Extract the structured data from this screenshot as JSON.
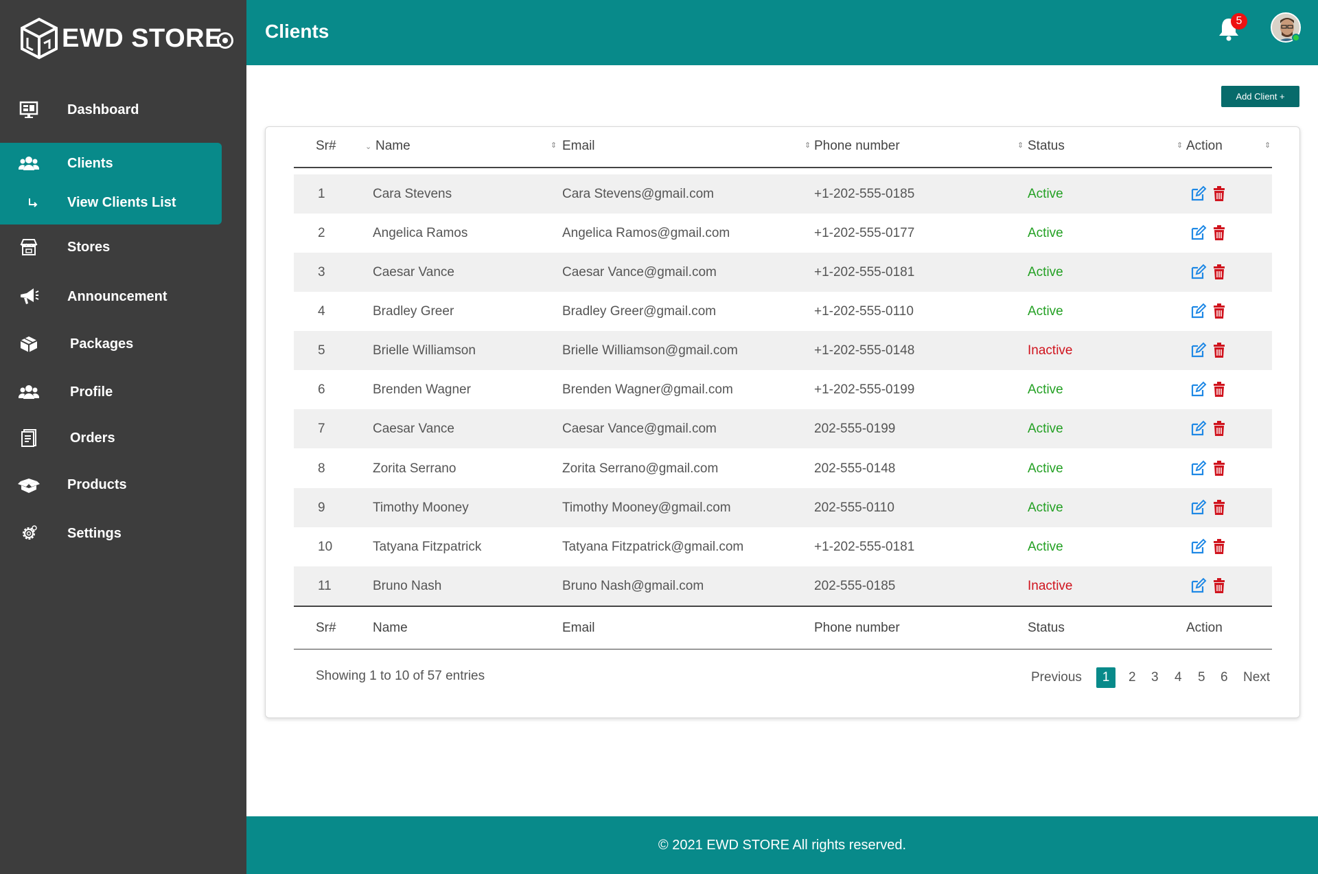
{
  "brand": {
    "name": "EWD STORE"
  },
  "header": {
    "title": "Clients",
    "notification_count": "5"
  },
  "sidebar": {
    "items": [
      {
        "label": "Dashboard",
        "icon": "monitor-icon"
      },
      {
        "label": "Clients",
        "icon": "users-icon"
      },
      {
        "label": "View Clients List",
        "icon": "subitem-arrow-icon"
      },
      {
        "label": "Stores",
        "icon": "store-icon"
      },
      {
        "label": "Announcement",
        "icon": "megaphone-icon"
      },
      {
        "label": "Packages",
        "icon": "packages-icon"
      },
      {
        "label": "Profile",
        "icon": "profile-icon"
      },
      {
        "label": "Orders",
        "icon": "orders-icon"
      },
      {
        "label": "Products",
        "icon": "products-icon"
      },
      {
        "label": "Settings",
        "icon": "gear-icon"
      }
    ]
  },
  "toolbar": {
    "add_label": "Add Client +"
  },
  "table": {
    "columns": [
      "Sr#",
      "Name",
      "Email",
      "Phone number",
      "Status",
      "Action"
    ],
    "rows": [
      {
        "sr": "1",
        "name": "Cara Stevens",
        "email": "Cara Stevens@gmail.com",
        "phone": "+1-202-555-0185",
        "status": "Active"
      },
      {
        "sr": "2",
        "name": "Angelica Ramos",
        "email": "Angelica Ramos@gmail.com",
        "phone": "+1-202-555-0177",
        "status": "Active"
      },
      {
        "sr": "3",
        "name": "Caesar Vance",
        "email": "Caesar Vance@gmail.com",
        "phone": "+1-202-555-0181",
        "status": "Active"
      },
      {
        "sr": "4",
        "name": "Bradley Greer",
        "email": "Bradley Greer@gmail.com",
        "phone": "+1-202-555-0110",
        "status": "Active"
      },
      {
        "sr": "5",
        "name": "Brielle Williamson",
        "email": "Brielle Williamson@gmail.com",
        "phone": "+1-202-555-0148",
        "status": "Inactive"
      },
      {
        "sr": "6",
        "name": "Brenden Wagner",
        "email": "Brenden Wagner@gmail.com",
        "phone": "+1-202-555-0199",
        "status": "Active"
      },
      {
        "sr": "7",
        "name": "Caesar Vance",
        "email": "Caesar Vance@gmail.com",
        "phone": "202-555-0199",
        "status": "Active"
      },
      {
        "sr": "8",
        "name": "Zorita Serrano",
        "email": "Zorita Serrano@gmail.com",
        "phone": "202-555-0148",
        "status": "Active"
      },
      {
        "sr": "9",
        "name": "Timothy Mooney",
        "email": "Timothy Mooney@gmail.com",
        "phone": "202-555-0110",
        "status": "Active"
      },
      {
        "sr": "10",
        "name": "Tatyana Fitzpatrick",
        "email": "Tatyana Fitzpatrick@gmail.com",
        "phone": "+1-202-555-0181",
        "status": "Active"
      },
      {
        "sr": "11",
        "name": "Bruno Nash",
        "email": "Bruno Nash@gmail.com",
        "phone": "202-555-0185",
        "status": "Inactive"
      }
    ],
    "info": "Showing 1 to 10 of 57 entries"
  },
  "pagination": {
    "previous": "Previous",
    "pages": [
      "1",
      "2",
      "3",
      "4",
      "5",
      "6"
    ],
    "next": "Next",
    "current": "1"
  },
  "footer": {
    "text": "© 2021 EWD STORE  All rights reserved."
  },
  "colors": {
    "teal": "#088a8a",
    "sidebar": "#3d3d3d",
    "active": "#23a023",
    "inactive": "#d0141e",
    "edit": "#1e88e5",
    "delete": "#d0141e"
  }
}
